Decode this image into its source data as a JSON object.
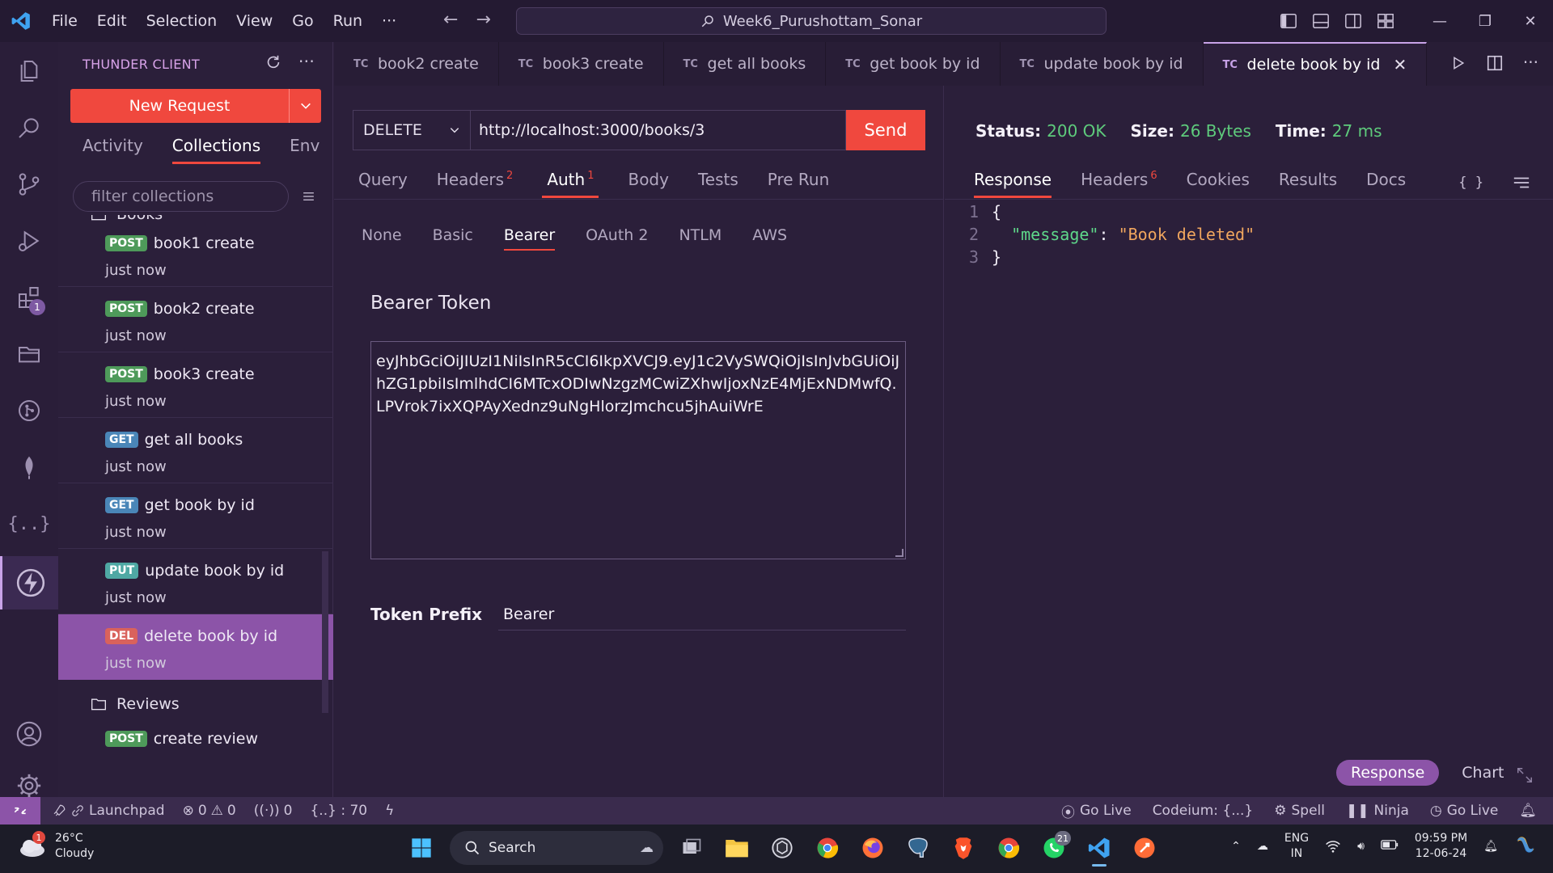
{
  "titlebar": {
    "menu": [
      "File",
      "Edit",
      "Selection",
      "View",
      "Go",
      "Run",
      "···"
    ],
    "search_text": "Week6_Purushottam_Sonar"
  },
  "activitybar": {
    "extensions_badge": "1"
  },
  "sidebar": {
    "header": "THUNDER CLIENT",
    "new_request": "New Request",
    "tabs": [
      "Activity",
      "Collections",
      "Env"
    ],
    "filter_placeholder": "filter collections",
    "folder_books": "Books",
    "requests": [
      {
        "method": "POST",
        "name": "book1 create",
        "time": "just now"
      },
      {
        "method": "POST",
        "name": "book2 create",
        "time": "just now"
      },
      {
        "method": "POST",
        "name": "book3 create",
        "time": "just now"
      },
      {
        "method": "GET",
        "name": "get all books",
        "time": "just now"
      },
      {
        "method": "GET",
        "name": "get book by id",
        "time": "just now"
      },
      {
        "method": "PUT",
        "name": "update book by id",
        "time": "just now"
      },
      {
        "method": "DEL",
        "name": "delete book by id",
        "time": "just now"
      }
    ],
    "folder_reviews": "Reviews",
    "review_request": {
      "method": "POST",
      "name": "create review"
    }
  },
  "editor_tabs": [
    {
      "prefix": "TC",
      "label": "book2 create"
    },
    {
      "prefix": "TC",
      "label": "book3 create"
    },
    {
      "prefix": "TC",
      "label": "get all books"
    },
    {
      "prefix": "TC",
      "label": "get book by id"
    },
    {
      "prefix": "TC",
      "label": "update book by id"
    },
    {
      "prefix": "TC",
      "label": "delete book by id"
    }
  ],
  "request": {
    "method": "DELETE",
    "url": "http://localhost:3000/books/3",
    "send": "Send",
    "tabs": {
      "query": "Query",
      "headers": "Headers",
      "headers_count": "2",
      "auth": "Auth",
      "auth_count": "1",
      "body": "Body",
      "tests": "Tests",
      "prerun": "Pre Run"
    },
    "auth_types": [
      "None",
      "Basic",
      "Bearer",
      "OAuth 2",
      "NTLM",
      "AWS"
    ],
    "bearer_title": "Bearer Token",
    "token": "eyJhbGciOiJIUzI1NiIsInR5cCI6IkpXVCJ9.eyJ1c2VySWQiOjIsInJvbGUiOiJhZG1pbiIsImlhdCI6MTcxODIwNzgzMCwiZXhwIjoxNzE4MjExNDMwfQ.LPVrok7ixXQPAyXednz9uNgHlorzJmchcu5jhAuiWrE",
    "token_prefix_label": "Token Prefix",
    "token_prefix_value": "Bearer"
  },
  "response": {
    "status_label": "Status:",
    "status_value": "200 OK",
    "size_label": "Size:",
    "size_value": "26 Bytes",
    "time_label": "Time:",
    "time_value": "27 ms",
    "tabs": {
      "response": "Response",
      "headers": "Headers",
      "headers_count": "6",
      "cookies": "Cookies",
      "results": "Results",
      "docs": "Docs"
    },
    "braces_tool": "{ }",
    "lines": [
      "1",
      "2",
      "3"
    ],
    "code_open": "{",
    "code_key": "\"message\"",
    "code_colon": ": ",
    "code_value": "\"Book deleted\"",
    "code_close": "}",
    "toggle_response": "Response",
    "toggle_chart": "Chart"
  },
  "statusbar": {
    "launchpad": "Launchpad",
    "errors": "0",
    "warnings": "0",
    "ports": "0",
    "braces": "{..} : 70",
    "go_live_1": "Go Live",
    "codeium": "Codeium: {...}",
    "spell": "Spell",
    "ninja": "Ninja",
    "go_live_2": "Go Live"
  },
  "taskbar": {
    "temp": "26°C",
    "weather": "Cloudy",
    "weather_badge": "1",
    "search": "Search",
    "whatsapp_badge": "21",
    "lang_1": "ENG",
    "lang_2": "IN",
    "time": "09:59 PM",
    "date": "12-06-24"
  },
  "colors": {
    "accent_red": "#f0483e",
    "accent_purple": "#8c54a8",
    "success_green": "#5ecb7c"
  }
}
